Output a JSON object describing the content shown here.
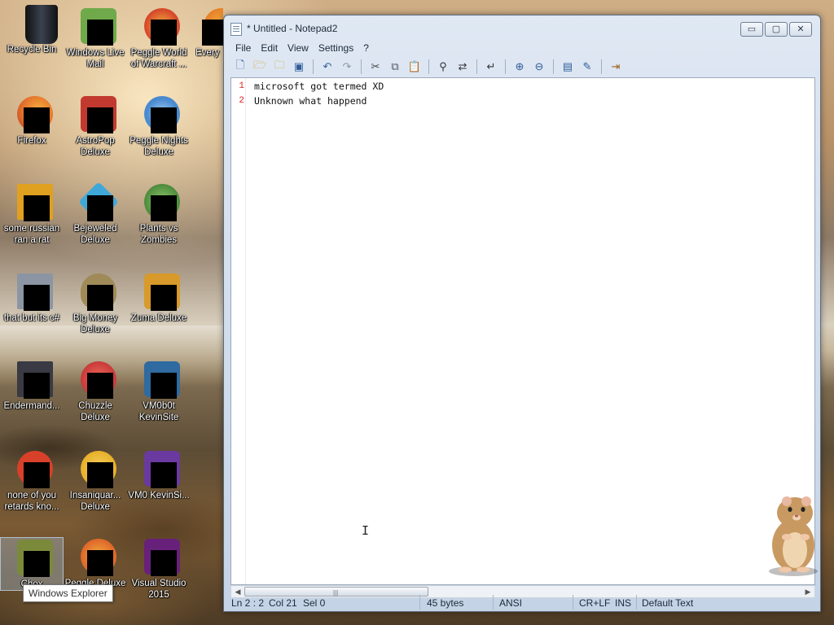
{
  "desktop": {
    "icons": [
      {
        "name": "Recycle Bin",
        "color": "#2a2f38"
      },
      {
        "name": "Windows Live Mail",
        "color": "#6fa94a"
      },
      {
        "name": "Peggle World of Warcraft ...",
        "color": "#d64a2a"
      },
      {
        "name": "Every",
        "color": "#e8832a"
      },
      {
        "name": "Firefox",
        "color": "#e4702a"
      },
      {
        "name": "AstroPop Deluxe",
        "color": "#c23a2f"
      },
      {
        "name": "Peggle Nights Deluxe",
        "color": "#4a8ad0"
      },
      {
        "name": "some russian ran a rat",
        "color": "#e0a020"
      },
      {
        "name": "Bejeweled Deluxe",
        "color": "#3fa8d8"
      },
      {
        "name": "Plants vs Zombies",
        "color": "#4c8a3c"
      },
      {
        "name": "that but its c#",
        "color": "#8c95a3"
      },
      {
        "name": "Big Money Deluxe",
        "color": "#a08a58"
      },
      {
        "name": "Zuma Deluxe",
        "color": "#d89a2a"
      },
      {
        "name": "Endermand...",
        "color": "#3a3a44"
      },
      {
        "name": "Chuzzle Deluxe",
        "color": "#c83a3a"
      },
      {
        "name": "VM0b0t KevinSite",
        "color": "#2f6aa0"
      },
      {
        "name": "none of you retards kno...",
        "color": "#d8402a"
      },
      {
        "name": "Insaniquar... Deluxe",
        "color": "#e8b02a"
      },
      {
        "name": "VM0 KevinSi...",
        "color": "#6a3aa0"
      },
      {
        "name": "Chox",
        "color": "#7b8a3a"
      },
      {
        "name": "Peggle Deluxe",
        "color": "#e06a2a"
      },
      {
        "name": "Visual Studio 2015",
        "color": "#68217a"
      }
    ],
    "tooltip": "Windows Explorer"
  },
  "window": {
    "title": "* Untitled - Notepad2",
    "buttons": {
      "minimize": "▭",
      "maximize": "▢",
      "close": "✕"
    },
    "menu": [
      "File",
      "Edit",
      "View",
      "Settings",
      "?"
    ],
    "toolbar_icons": [
      "new-file-icon",
      "open-folder-icon",
      "browse-icon",
      "save-icon",
      "undo-icon",
      "redo-icon",
      "cut-icon",
      "copy-icon",
      "paste-icon",
      "find-icon",
      "replace-icon",
      "word-wrap-icon",
      "zoom-in-icon",
      "zoom-out-icon",
      "view-scheme-icon",
      "customize-icon",
      "exit-icon"
    ],
    "lines": [
      {
        "number": "1",
        "text": "microsoft got termed XD"
      },
      {
        "number": "2",
        "text": "Unknown what happend"
      }
    ],
    "status": {
      "position": "Ln 2 : 2",
      "column": "Col 21",
      "selection": "Sel 0",
      "size": "45 bytes",
      "encoding": "ANSI",
      "line_ending": "CR+LF",
      "mode": "INS",
      "scheme": "Default Text"
    }
  }
}
